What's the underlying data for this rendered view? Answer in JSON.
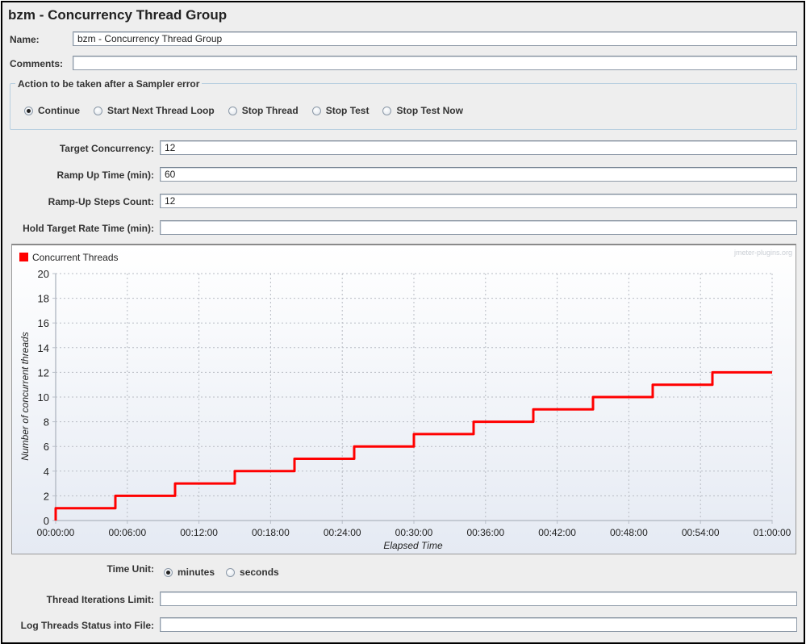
{
  "panel": {
    "title": "bzm - Concurrency Thread Group"
  },
  "name_field": {
    "label": "Name:",
    "value": "bzm - Concurrency Thread Group"
  },
  "comments_field": {
    "label": "Comments:",
    "value": ""
  },
  "sampler_error": {
    "title": "Action to be taken after a Sampler error",
    "options": [
      {
        "label": "Continue",
        "selected": true
      },
      {
        "label": "Start Next Thread Loop",
        "selected": false
      },
      {
        "label": "Stop Thread",
        "selected": false
      },
      {
        "label": "Stop Test",
        "selected": false
      },
      {
        "label": "Stop Test Now",
        "selected": false
      }
    ]
  },
  "settings": {
    "target_concurrency": {
      "label": "Target Concurrency:",
      "value": "12"
    },
    "ramp_up_time": {
      "label": "Ramp Up Time (min):",
      "value": "60"
    },
    "ramp_up_steps": {
      "label": "Ramp-Up Steps Count:",
      "value": "12"
    },
    "hold_time": {
      "label": "Hold Target Rate Time (min):",
      "value": ""
    }
  },
  "time_unit": {
    "label": "Time Unit:",
    "options": [
      {
        "label": "minutes",
        "selected": true
      },
      {
        "label": "seconds",
        "selected": false
      }
    ]
  },
  "iterations_limit": {
    "label": "Thread Iterations Limit:",
    "value": ""
  },
  "log_file": {
    "label": "Log Threads Status into File:",
    "value": ""
  },
  "chart_data": {
    "type": "line",
    "title": "",
    "watermark": "jmeter-plugins.org",
    "legend": {
      "entries": [
        "Concurrent Threads"
      ],
      "position": "top-left"
    },
    "xlabel": "Elapsed Time",
    "ylabel": "Number of concurrent threads",
    "xlim_minutes": [
      0,
      60
    ],
    "ylim": [
      0,
      20
    ],
    "grid": true,
    "x_ticks": [
      "00:00:00",
      "00:06:00",
      "00:12:00",
      "00:18:00",
      "00:24:00",
      "00:30:00",
      "00:36:00",
      "00:42:00",
      "00:48:00",
      "00:54:00",
      "01:00:00"
    ],
    "y_ticks": [
      "0",
      "2",
      "4",
      "6",
      "8",
      "10",
      "12",
      "14",
      "16",
      "18",
      "20"
    ],
    "series": [
      {
        "name": "Concurrent Threads",
        "color": "#ff0000",
        "step": true,
        "x_minutes": [
          0,
          5,
          10,
          15,
          20,
          25,
          30,
          35,
          40,
          45,
          50,
          55,
          60
        ],
        "values": [
          1,
          2,
          3,
          4,
          5,
          6,
          7,
          8,
          9,
          10,
          11,
          12,
          12
        ]
      }
    ]
  }
}
